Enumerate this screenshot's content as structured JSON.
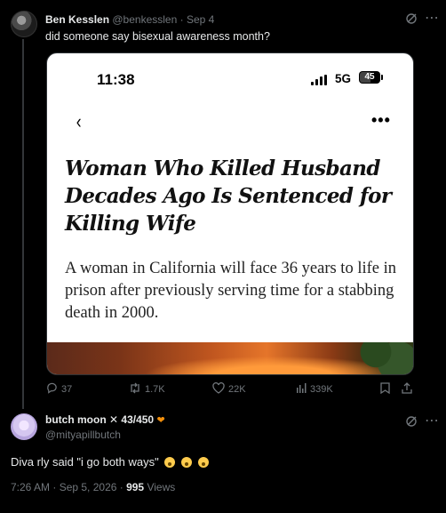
{
  "tweet1": {
    "author_name": "Ben Kesslen",
    "author_handle": "@benkesslen",
    "separator": " · ",
    "date": "Sep 4",
    "text": "did someone say bisexual awareness month?",
    "icons": {
      "grok": "grok-icon",
      "more": "more-horizontal-icon"
    },
    "embedded_screenshot": {
      "status_time": "11:38",
      "network": "5G",
      "battery": "45",
      "headline": "Woman Who Killed Husband Decades Ago Is Sentenced for Killing Wife",
      "summary": "A woman in California will face 36 years to life in prison after previously serving time for a stabbing death in 2000."
    },
    "actions": {
      "replies": "37",
      "reposts": "1.7K",
      "likes": "22K",
      "views": "339K"
    }
  },
  "tweet2": {
    "author_name": "butch moon",
    "author_badge": "43/450",
    "author_handle": "@mityapillbutch",
    "text": "Diva rly said \"i go both ways\"",
    "timestamp": "7:26 AM · Sep 5, 2026 · ",
    "views_count": "995",
    "views_label": " Views"
  },
  "colors": {
    "background": "#000000",
    "text": "#e7e9ea",
    "muted": "#71767b",
    "heart": "#f4900c"
  }
}
